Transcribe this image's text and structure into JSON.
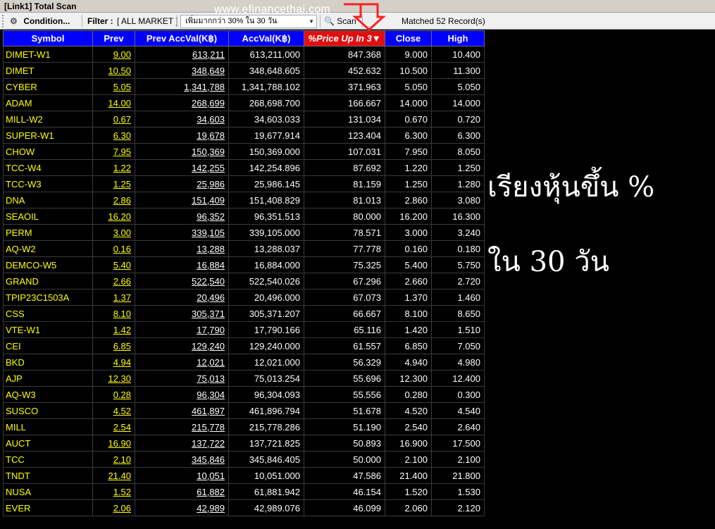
{
  "window": {
    "title": "[Link1] Total Scan"
  },
  "toolbar": {
    "condition_label": "Condition...",
    "filter_label": "Filter :",
    "filter_value": "[ ALL MARKET ]",
    "dropdown_value": "เพิ่มมากกว่า 30% ใน 30 วัน",
    "scan_label": "Scan",
    "matched_text": "Matched 52 Record(s)"
  },
  "watermark": "www.efinancethai.com",
  "colors": {
    "header_bg": "#0000ff",
    "active_header_bg": "#e01010",
    "symbol_color": "#ffff00",
    "background": "#000000"
  },
  "table": {
    "columns": [
      "Symbol",
      "Prev",
      "Prev AccVal(K฿)",
      "AccVal(K฿)",
      "%Price Up In 3▼",
      "Close",
      "High"
    ],
    "sorted_column_index": 4,
    "rows": [
      [
        "DIMET-W1",
        "9.00",
        "613,211",
        "613,211.000",
        "847.368",
        "9.000",
        "10.400"
      ],
      [
        "DIMET",
        "10.50",
        "348,649",
        "348,648.605",
        "452.632",
        "10.500",
        "11.300"
      ],
      [
        "CYBER",
        "5.05",
        "1,341,788",
        "1,341,788.102",
        "371.963",
        "5.050",
        "5.050"
      ],
      [
        "ADAM",
        "14.00",
        "268,699",
        "268,698.700",
        "166.667",
        "14.000",
        "14.000"
      ],
      [
        "MILL-W2",
        "0.67",
        "34,603",
        "34,603.033",
        "131.034",
        "0.670",
        "0.720"
      ],
      [
        "SUPER-W1",
        "6.30",
        "19,678",
        "19,677.914",
        "123.404",
        "6.300",
        "6.300"
      ],
      [
        "CHOW",
        "7.95",
        "150,369",
        "150,369.000",
        "107.031",
        "7.950",
        "8.050"
      ],
      [
        "TCC-W4",
        "1.22",
        "142,255",
        "142,254.896",
        "87.692",
        "1.220",
        "1.250"
      ],
      [
        "TCC-W3",
        "1.25",
        "25,986",
        "25,986.145",
        "81.159",
        "1.250",
        "1.280"
      ],
      [
        "DNA",
        "2.86",
        "151,409",
        "151,408.829",
        "81.013",
        "2.860",
        "3.080"
      ],
      [
        "SEAOIL",
        "16.20",
        "96,352",
        "96,351.513",
        "80.000",
        "16.200",
        "16.300"
      ],
      [
        "PERM",
        "3.00",
        "339,105",
        "339,105.000",
        "78.571",
        "3.000",
        "3.240"
      ],
      [
        "AQ-W2",
        "0.16",
        "13,288",
        "13,288.037",
        "77.778",
        "0.160",
        "0.180"
      ],
      [
        "DEMCO-W5",
        "5.40",
        "16,884",
        "16,884.000",
        "75.325",
        "5.400",
        "5.750"
      ],
      [
        "GRAND",
        "2.66",
        "522,540",
        "522,540.026",
        "67.296",
        "2.660",
        "2.720"
      ],
      [
        "TPIP23C1503A",
        "1.37",
        "20,496",
        "20,496.000",
        "67.073",
        "1.370",
        "1.460"
      ],
      [
        "CSS",
        "8.10",
        "305,371",
        "305,371.207",
        "66.667",
        "8.100",
        "8.650"
      ],
      [
        "VTE-W1",
        "1.42",
        "17,790",
        "17,790.166",
        "65.116",
        "1.420",
        "1.510"
      ],
      [
        "CEI",
        "6.85",
        "129,240",
        "129,240.000",
        "61.557",
        "6.850",
        "7.050"
      ],
      [
        "BKD",
        "4.94",
        "12,021",
        "12,021.000",
        "56.329",
        "4.940",
        "4.980"
      ],
      [
        "AJP",
        "12.30",
        "75,013",
        "75,013.254",
        "55.696",
        "12.300",
        "12.400"
      ],
      [
        "AQ-W3",
        "0.28",
        "96,304",
        "96,304.093",
        "55.556",
        "0.280",
        "0.300"
      ],
      [
        "SUSCO",
        "4.52",
        "461,897",
        "461,896.794",
        "51.678",
        "4.520",
        "4.540"
      ],
      [
        "MILL",
        "2.54",
        "215,778",
        "215,778.286",
        "51.190",
        "2.540",
        "2.640"
      ],
      [
        "AUCT",
        "16.90",
        "137,722",
        "137,721.825",
        "50.893",
        "16.900",
        "17.500"
      ],
      [
        "TCC",
        "2.10",
        "345,846",
        "345,846.405",
        "50.000",
        "2.100",
        "2.100"
      ],
      [
        "TNDT",
        "21.40",
        "10,051",
        "10,051.000",
        "47.586",
        "21.400",
        "21.800"
      ],
      [
        "NUSA",
        "1.52",
        "61,882",
        "61,881.942",
        "46.154",
        "1.520",
        "1.530"
      ],
      [
        "EVER",
        "2.06",
        "42,989",
        "42,989.076",
        "46.099",
        "2.060",
        "2.120"
      ]
    ]
  },
  "caption": {
    "line1": "เรียงหุ้นขึ้น %",
    "line2": "ใน 30 วัน"
  }
}
